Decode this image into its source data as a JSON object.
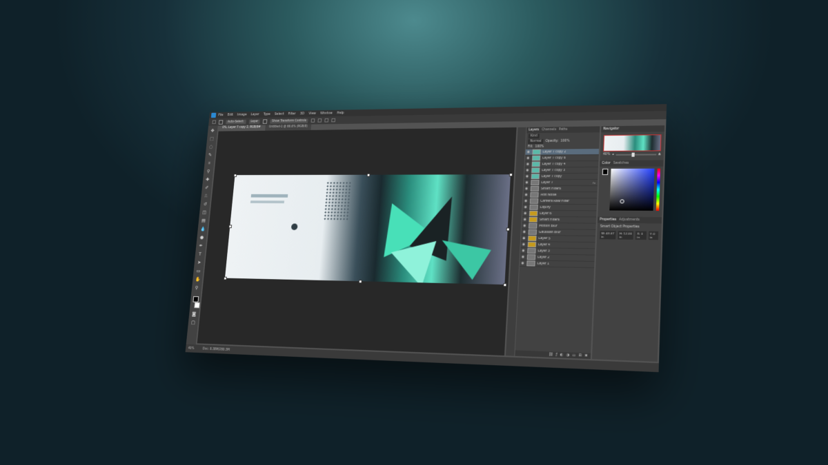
{
  "app": {
    "name": "Photoshop",
    "menu": [
      "File",
      "Edit",
      "Image",
      "Layer",
      "Type",
      "Select",
      "Filter",
      "3D",
      "View",
      "Window",
      "Help"
    ]
  },
  "options_bar": {
    "auto_select": "Auto-Select:",
    "target": "Layer",
    "show_transform": "Show Transform Controls"
  },
  "tabs": [
    {
      "label": "0%, Layer 7 copy 2, RGB/8#",
      "active": true
    },
    {
      "label": "Untitled-1 @ 66.6% (RGB/8)",
      "active": false
    }
  ],
  "layers_panel": {
    "tabs": [
      "Layers",
      "Channels",
      "Paths"
    ],
    "kind_filter": "Kind",
    "blend_mode": "Normal",
    "opacity_label": "Opacity:",
    "opacity_value": "100%",
    "fill_label": "Fill:",
    "fill_value": "100%",
    "layers": [
      {
        "name": "Layer 7 copy 2",
        "thumb": "teal",
        "selected": true,
        "fx": false
      },
      {
        "name": "Layer 7 copy 6",
        "thumb": "teal",
        "selected": false,
        "fx": false
      },
      {
        "name": "Layer 7 copy 4",
        "thumb": "teal",
        "selected": false,
        "fx": false
      },
      {
        "name": "Layer 7 copy 3",
        "thumb": "teal",
        "selected": false,
        "fx": false
      },
      {
        "name": "Layer 7 copy",
        "thumb": "teal",
        "selected": false,
        "fx": false
      },
      {
        "name": "Layer 7",
        "thumb": "gray",
        "selected": false,
        "fx": true
      },
      {
        "name": "Smart Filters",
        "thumb": "gray",
        "selected": false,
        "fx": false
      },
      {
        "name": "Add Noise",
        "thumb": "gray",
        "selected": false,
        "fx": false
      },
      {
        "name": "Camera Raw Filter",
        "thumb": "gray",
        "selected": false,
        "fx": false
      },
      {
        "name": "Liquify",
        "thumb": "gray",
        "selected": false,
        "fx": false
      },
      {
        "name": "Layer 6",
        "thumb": "yellow",
        "selected": false,
        "fx": false
      },
      {
        "name": "Smart Filters",
        "thumb": "yellow",
        "selected": false,
        "fx": false
      },
      {
        "name": "Motion Blur",
        "thumb": "gray",
        "selected": false,
        "fx": false
      },
      {
        "name": "Gaussian Blur",
        "thumb": "gray",
        "selected": false,
        "fx": false
      },
      {
        "name": "Layer 5",
        "thumb": "yellow",
        "selected": false,
        "fx": false
      },
      {
        "name": "Layer 4",
        "thumb": "yellow",
        "selected": false,
        "fx": false
      },
      {
        "name": "Layer 3",
        "thumb": "gray",
        "selected": false,
        "fx": false
      },
      {
        "name": "Layer 2",
        "thumb": "gray",
        "selected": false,
        "fx": false
      },
      {
        "name": "Layer 1",
        "thumb": "gray",
        "selected": false,
        "fx": false
      }
    ],
    "footer_icons": [
      "link-icon",
      "fx-icon",
      "mask-icon",
      "adjustment-icon",
      "folder-icon",
      "new-layer-icon",
      "trash-icon"
    ]
  },
  "navigator": {
    "title": "Navigator",
    "zoom_value": "40%"
  },
  "color_panel": {
    "tabs": [
      "Color",
      "Swatches"
    ],
    "fg_color": "#000000",
    "bg_color": "#ffffff"
  },
  "properties_panel": {
    "tabs": [
      "Properties",
      "Adjustments"
    ],
    "title": "Smart Object Properties",
    "fields": [
      "W: 43.07 in",
      "H: 12.00 in",
      "X: 0 in",
      "Y: 0 in"
    ]
  },
  "status_bar": {
    "zoom": "40%",
    "doc": "Doc: 8.38M/280.3M"
  },
  "colors": {
    "accent_layer_selected": "#5a6c7d",
    "artwork_teal": "#48e0b8",
    "ps_blue": "#2a8ad4"
  }
}
